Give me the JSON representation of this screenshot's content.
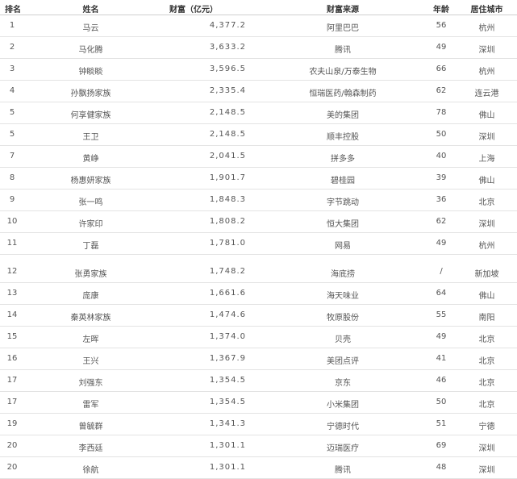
{
  "header": {
    "rank": "排名",
    "name": "姓名",
    "wealth": "财富（亿元）",
    "source": "财富来源",
    "age": "年龄",
    "city": "居住城市"
  },
  "rows": [
    {
      "rank": "1",
      "name": "马云",
      "wealth": "4,377.2",
      "source": "阿里巴巴",
      "age": "56",
      "city": "杭州"
    },
    {
      "rank": "2",
      "name": "马化腾",
      "wealth": "3,633.2",
      "source": "腾讯",
      "age": "49",
      "city": "深圳"
    },
    {
      "rank": "3",
      "name": "钟睒睒",
      "wealth": "3,596.5",
      "source": "农夫山泉/万泰生物",
      "age": "66",
      "city": "杭州"
    },
    {
      "rank": "4",
      "name": "孙飘扬家族",
      "wealth": "2,335.4",
      "source": "恒瑞医药/翰森制药",
      "age": "62",
      "city": "连云港"
    },
    {
      "rank": "5",
      "name": "何享健家族",
      "wealth": "2,148.5",
      "source": "美的集团",
      "age": "78",
      "city": "佛山"
    },
    {
      "rank": "5",
      "name": "王卫",
      "wealth": "2,148.5",
      "source": "顺丰控股",
      "age": "50",
      "city": "深圳"
    },
    {
      "rank": "7",
      "name": "黄峥",
      "wealth": "2,041.5",
      "source": "拼多多",
      "age": "40",
      "city": "上海"
    },
    {
      "rank": "8",
      "name": "杨惠妍家族",
      "wealth": "1,901.7",
      "source": "碧桂园",
      "age": "39",
      "city": "佛山"
    },
    {
      "rank": "9",
      "name": "张一鸣",
      "wealth": "1,848.3",
      "source": "字节跳动",
      "age": "36",
      "city": "北京"
    },
    {
      "rank": "10",
      "name": "许家印",
      "wealth": "1,808.2",
      "source": "恒大集团",
      "age": "62",
      "city": "深圳"
    },
    {
      "rank": "11",
      "name": "丁磊",
      "wealth": "1,781.0",
      "source": "网易",
      "age": "49",
      "city": "杭州"
    },
    {
      "rank": "12",
      "name": "张勇家族",
      "wealth": "1,748.2",
      "source": "海底捞",
      "age": "/",
      "city": "新加坡"
    },
    {
      "rank": "13",
      "name": "庞康",
      "wealth": "1,661.6",
      "source": "海天味业",
      "age": "64",
      "city": "佛山"
    },
    {
      "rank": "14",
      "name": "秦英林家族",
      "wealth": "1,474.6",
      "source": "牧原股份",
      "age": "55",
      "city": "南阳"
    },
    {
      "rank": "15",
      "name": "左晖",
      "wealth": "1,374.0",
      "source": "贝壳",
      "age": "49",
      "city": "北京"
    },
    {
      "rank": "16",
      "name": "王兴",
      "wealth": "1,367.9",
      "source": "美团点评",
      "age": "41",
      "city": "北京"
    },
    {
      "rank": "17",
      "name": "刘强东",
      "wealth": "1,354.5",
      "source": "京东",
      "age": "46",
      "city": "北京"
    },
    {
      "rank": "17",
      "name": "雷军",
      "wealth": "1,354.5",
      "source": "小米集团",
      "age": "50",
      "city": "北京"
    },
    {
      "rank": "19",
      "name": "曾毓群",
      "wealth": "1,341.3",
      "source": "宁德时代",
      "age": "51",
      "city": "宁德"
    },
    {
      "rank": "20",
      "name": "李西廷",
      "wealth": "1,301.1",
      "source": "迈瑞医疗",
      "age": "69",
      "city": "深圳"
    },
    {
      "rank": "20",
      "name": "徐航",
      "wealth": "1,301.1",
      "source": "腾讯",
      "age": "48",
      "city": "深圳"
    }
  ]
}
